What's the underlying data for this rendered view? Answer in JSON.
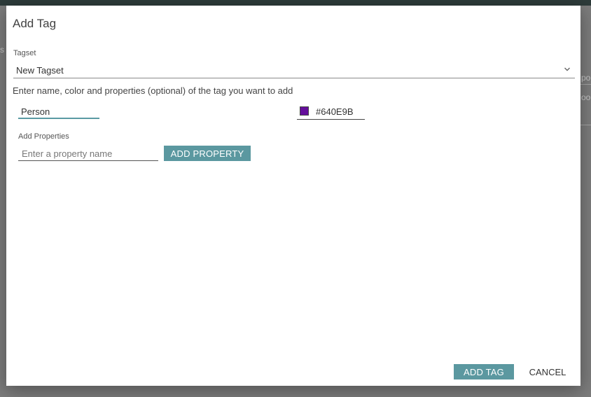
{
  "background": {
    "fragment_left": "s",
    "fragment_right_1": "po",
    "fragment_right_2": "oo"
  },
  "dialog": {
    "title": "Add Tag",
    "tagset": {
      "label": "Tagset",
      "selected": "New Tagset",
      "icon": "chevron-down-icon"
    },
    "instructions": "Enter name, color and properties (optional) of the tag you want to add",
    "name_input": {
      "value": "Person"
    },
    "color": {
      "value": "#640E9B",
      "swatch_color": "#640E9B"
    },
    "properties": {
      "label": "Add Properties",
      "placeholder": "Enter a property name",
      "add_button": "ADD PROPERTY"
    },
    "footer": {
      "add_tag_button": "ADD TAG",
      "cancel_button": "CANCEL"
    }
  },
  "colors": {
    "accent": "#5B98A0",
    "topbar": "#2D3B3A",
    "overlay": "#7C7C7C"
  }
}
